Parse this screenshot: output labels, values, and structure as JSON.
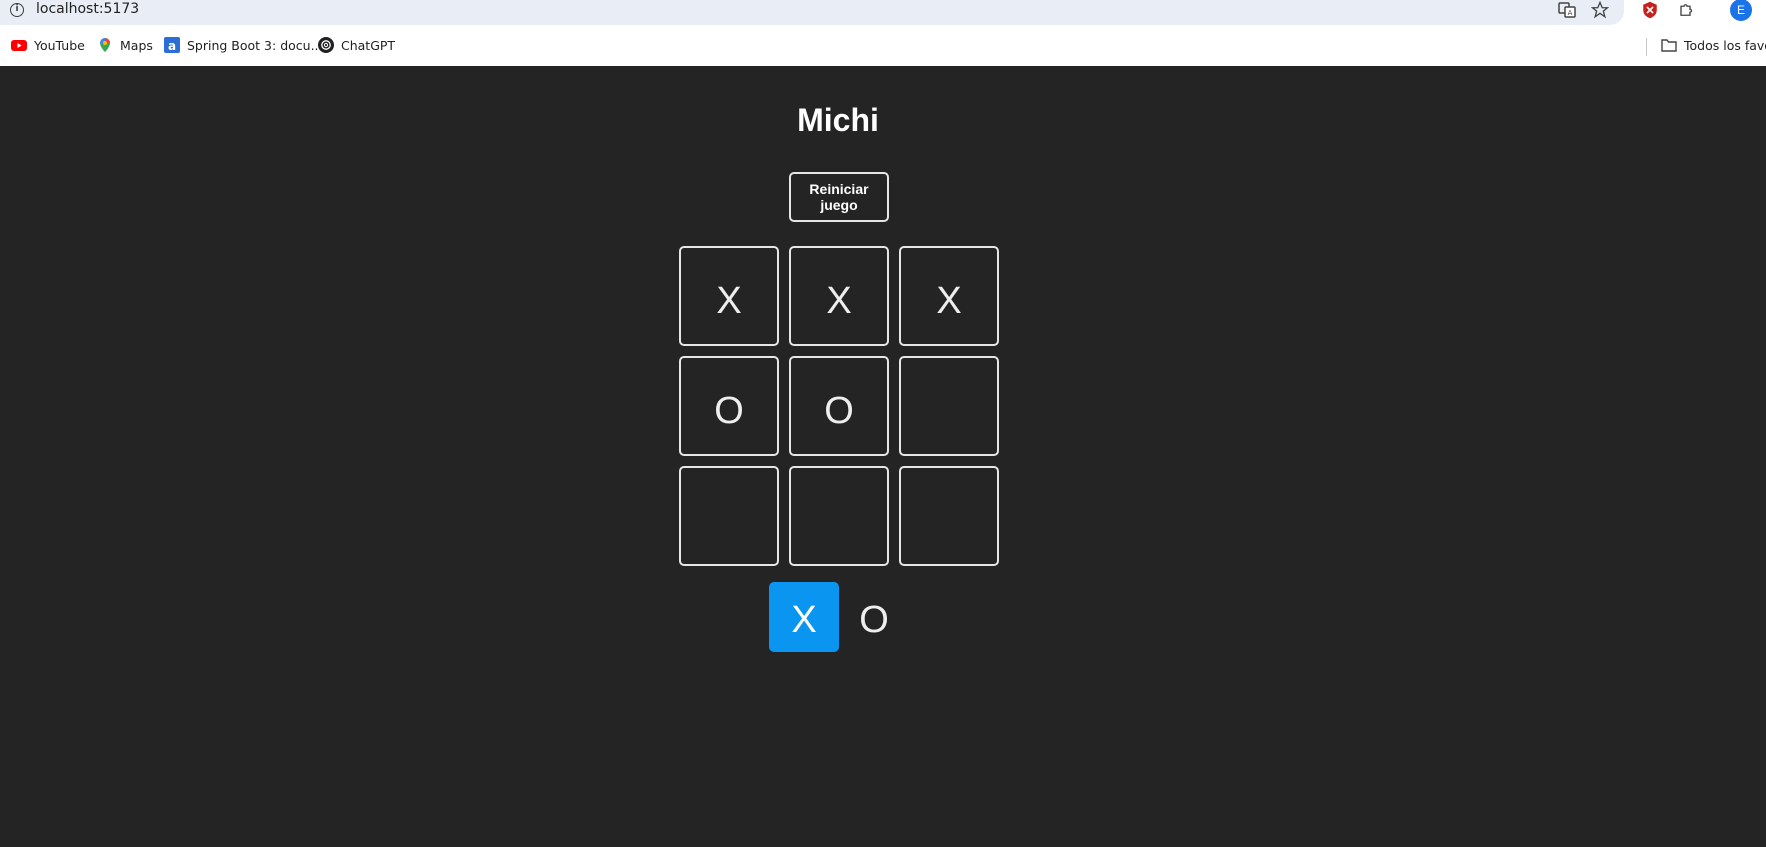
{
  "browser": {
    "url": "localhost:5173",
    "avatar_letter": "E",
    "bookmarks": [
      {
        "label": "YouTube",
        "icon": "youtube-icon"
      },
      {
        "label": "Maps",
        "icon": "maps-pin-icon"
      },
      {
        "label": "Spring Boot 3: docu...",
        "icon": "document-a-icon"
      },
      {
        "label": "ChatGPT",
        "icon": "chatgpt-icon"
      }
    ],
    "all_bookmarks_label": "Todos los favor"
  },
  "game": {
    "title": "Michi",
    "reset_label": "Reiniciar juego",
    "board": [
      "X",
      "X",
      "X",
      "O",
      "O",
      "",
      "",
      "",
      ""
    ],
    "turn_x": "X",
    "turn_o": "O",
    "current_turn": "X",
    "accent_color": "#0a96f0",
    "background_color": "#242424"
  }
}
